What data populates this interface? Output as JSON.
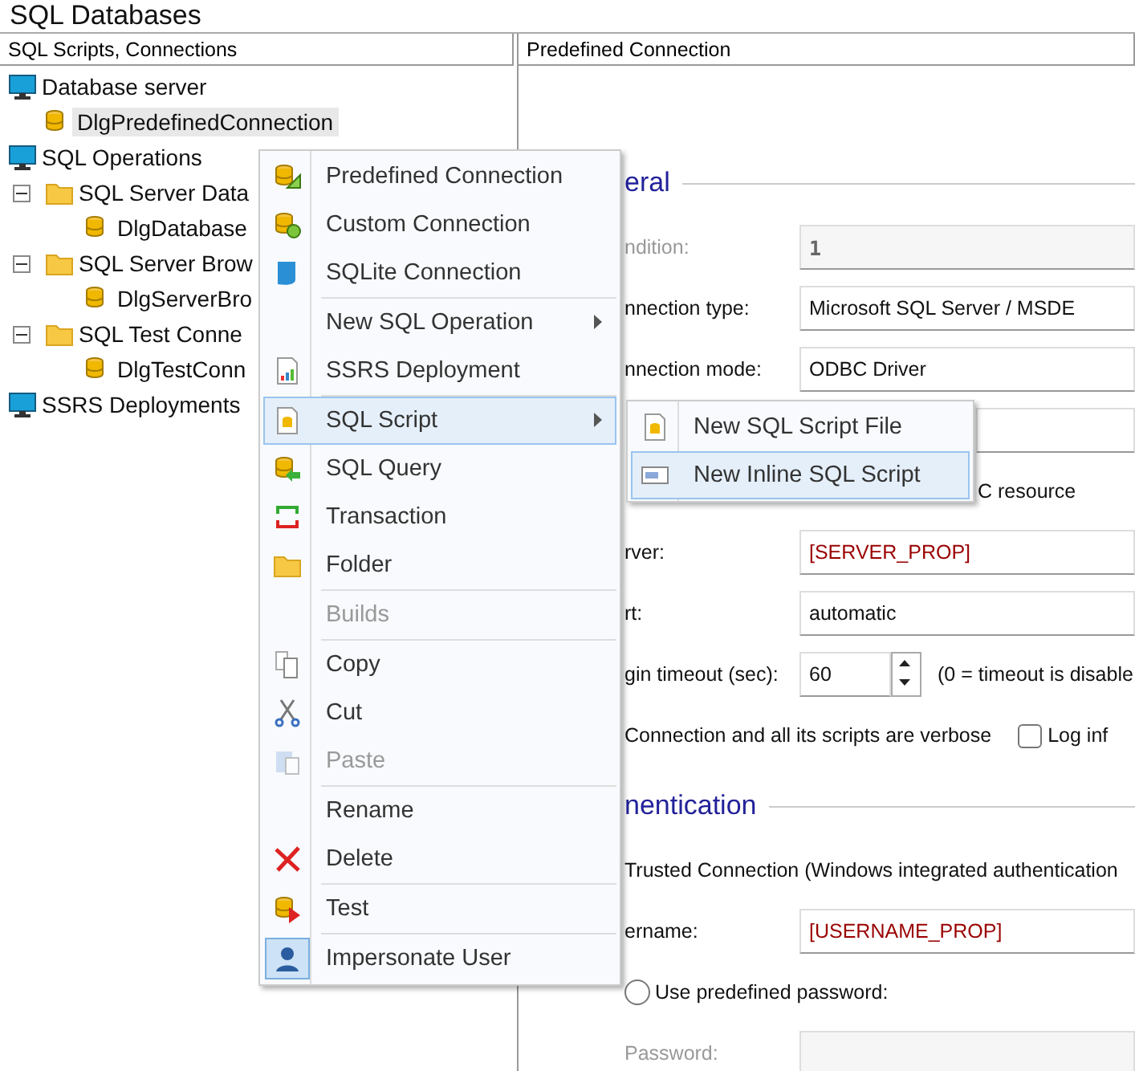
{
  "window": {
    "title": "SQL Databases"
  },
  "tree_panel": {
    "header": "SQL Scripts, Connections",
    "items": [
      {
        "label": "Database server",
        "kind": "group",
        "selected": false,
        "children": [
          {
            "label": "DlgPredefinedConnection",
            "kind": "connection",
            "selected": true
          }
        ]
      },
      {
        "label": "SQL Operations",
        "kind": "group",
        "selected": false,
        "children": [
          {
            "label": "SQL Server Data",
            "kind": "folder",
            "selected": false,
            "expanded": true,
            "children": [
              {
                "label": "DlgDatabase",
                "kind": "connection",
                "selected": false
              }
            ]
          },
          {
            "label": "SQL Server Brow",
            "kind": "folder",
            "selected": false,
            "expanded": true,
            "children": [
              {
                "label": "DlgServerBro",
                "kind": "connection",
                "selected": false
              }
            ]
          },
          {
            "label": "SQL Test Conne",
            "kind": "folder",
            "selected": false,
            "expanded": true,
            "children": [
              {
                "label": "DlgTestConn",
                "kind": "connection",
                "selected": false
              }
            ]
          }
        ]
      },
      {
        "label": "SSRS Deployments",
        "kind": "group",
        "selected": false
      }
    ]
  },
  "connection_panel": {
    "header": "Predefined Connection",
    "sections": [
      {
        "heading": "eral",
        "rows": [
          {
            "kind": "field",
            "label": "ndition:",
            "value": "1",
            "disabled": true,
            "property": false
          },
          {
            "kind": "field",
            "label": "nnection type:",
            "value": "Microsoft SQL Server / MSDE",
            "disabled": false,
            "property": false
          },
          {
            "kind": "field",
            "label": "nnection mode:",
            "value": "ODBC Driver",
            "disabled": false,
            "property": false
          },
          {
            "kind": "bare_field"
          },
          {
            "kind": "note",
            "text": "C resource"
          },
          {
            "kind": "field",
            "label": "rver:",
            "value": "[SERVER_PROP]",
            "disabled": false,
            "property": true
          },
          {
            "kind": "field",
            "label": "rt:",
            "value": "automatic",
            "disabled": false,
            "property": false
          },
          {
            "kind": "spin",
            "label": "gin timeout (sec):",
            "value": "60",
            "note": "(0 = timeout is disable"
          },
          {
            "kind": "checks",
            "text": "Connection and all its scripts are verbose",
            "option": {
              "label": "Log inf",
              "checked": false
            }
          }
        ]
      },
      {
        "heading": "nentication",
        "rows": [
          {
            "kind": "text",
            "text": "Trusted Connection (Windows integrated authentication"
          },
          {
            "kind": "field",
            "label": "ername:",
            "value": "[USERNAME_PROP]",
            "disabled": false,
            "property": true
          },
          {
            "kind": "radio",
            "label": "Use predefined password:",
            "selected": false
          },
          {
            "kind": "empty_field",
            "label": "Password:",
            "disabled": true
          }
        ]
      }
    ]
  },
  "context_menu": {
    "items": [
      {
        "kind": "item",
        "label": "Predefined Connection",
        "disabled": false,
        "selected": false,
        "submenu": false,
        "checked": false
      },
      {
        "kind": "item",
        "label": "Custom Connection",
        "disabled": false,
        "selected": false,
        "submenu": false,
        "checked": false
      },
      {
        "kind": "item",
        "label": "SQLite Connection",
        "disabled": false,
        "selected": false,
        "submenu": false,
        "checked": false
      },
      {
        "kind": "separator"
      },
      {
        "kind": "item",
        "label": "New SQL Operation",
        "disabled": false,
        "selected": false,
        "submenu": true,
        "checked": false
      },
      {
        "kind": "item",
        "label": "SSRS Deployment",
        "disabled": false,
        "selected": false,
        "submenu": false,
        "checked": false
      },
      {
        "kind": "separator"
      },
      {
        "kind": "item",
        "label": "SQL Script",
        "disabled": false,
        "selected": true,
        "submenu": true,
        "checked": false
      },
      {
        "kind": "item",
        "label": "SQL Query",
        "disabled": false,
        "selected": false,
        "submenu": false,
        "checked": false
      },
      {
        "kind": "item",
        "label": "Transaction",
        "disabled": false,
        "selected": false,
        "submenu": false,
        "checked": false
      },
      {
        "kind": "item",
        "label": "Folder",
        "disabled": false,
        "selected": false,
        "submenu": false,
        "checked": false
      },
      {
        "kind": "separator"
      },
      {
        "kind": "item",
        "label": "Builds",
        "disabled": true,
        "selected": false,
        "submenu": false,
        "checked": false
      },
      {
        "kind": "separator"
      },
      {
        "kind": "item",
        "label": "Copy",
        "disabled": false,
        "selected": false,
        "submenu": false,
        "checked": false
      },
      {
        "kind": "item",
        "label": "Cut",
        "disabled": false,
        "selected": false,
        "submenu": false,
        "checked": false
      },
      {
        "kind": "item",
        "label": "Paste",
        "disabled": true,
        "selected": false,
        "submenu": false,
        "checked": false
      },
      {
        "kind": "separator"
      },
      {
        "kind": "item",
        "label": "Rename",
        "disabled": false,
        "selected": false,
        "submenu": false,
        "checked": false
      },
      {
        "kind": "item",
        "label": "Delete",
        "disabled": false,
        "selected": false,
        "submenu": false,
        "checked": false
      },
      {
        "kind": "separator"
      },
      {
        "kind": "item",
        "label": "Test",
        "disabled": false,
        "selected": false,
        "submenu": false,
        "checked": false
      },
      {
        "kind": "separator"
      },
      {
        "kind": "item",
        "label": "Impersonate User",
        "disabled": false,
        "selected": false,
        "submenu": false,
        "checked": true
      }
    ]
  },
  "submenu": {
    "items": [
      {
        "label": "New SQL Script File",
        "selected": false
      },
      {
        "label": "New Inline SQL Script",
        "selected": true
      }
    ]
  }
}
